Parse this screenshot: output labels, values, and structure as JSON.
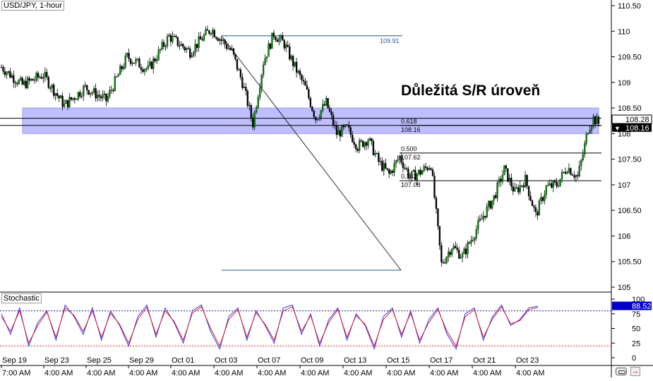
{
  "window": {
    "symbol_label": "USD/JPY, 1-hour",
    "indicator_label": "Stochastic",
    "bottom_icons": [
      "link-icon",
      "arrow-right-icon"
    ]
  },
  "colors": {
    "up_candle": "#0a8a0a",
    "down_candle": "#000000",
    "sr_zone_fill": "#b4b4ff",
    "sr_zone_edge": "#8c8cf0",
    "fib_line": "#1a5aa0",
    "stoch_k": "#3333ff",
    "stoch_d": "#dd2222",
    "overbought_line": "#1a1aa0",
    "oversold_line": "#dd2222",
    "last_price_tag": "#000000",
    "stoch_tag": "#0000cc"
  },
  "annotation": {
    "text": "Důležitá S/R úroveň"
  },
  "chart_data": [
    {
      "type": "candlestick",
      "title": "USD/JPY, 1-hour",
      "ylim": [
        105.0,
        110.6
      ],
      "y_ticks": [
        "110.50",
        "110",
        "109.50",
        "109",
        "108.50",
        "108",
        "107.50",
        "107",
        "106.50",
        "106",
        "105.50",
        "105"
      ],
      "x_ticks": [
        "Sep 19",
        "Sep 23",
        "Sep 25",
        "Sep 29",
        "Oct 01",
        "Oct 03",
        "Oct 07",
        "Oct 09",
        "Oct 13",
        "Oct 15",
        "Oct 17",
        "Oct 21",
        "Oct 23"
      ],
      "x_subticks": [
        "7:00 AM",
        "4:00 AM",
        "4:00 AM",
        "4:00 AM",
        "4:00 AM",
        "4:00 AM",
        "4:00 AM",
        "4:00 AM",
        "4:00 AM",
        "4:00 AM",
        "4:00 AM",
        "4:00 AM",
        "4:00 AM"
      ],
      "price_path": [
        [
          0,
          109.3
        ],
        [
          4,
          108.95
        ],
        [
          8,
          109.15
        ],
        [
          12,
          108.55
        ],
        [
          16,
          108.9
        ],
        [
          20,
          108.65
        ],
        [
          24,
          109.5
        ],
        [
          28,
          109.25
        ],
        [
          32,
          109.9
        ],
        [
          36,
          109.6
        ],
        [
          40,
          110.05
        ],
        [
          44,
          109.6
        ],
        [
          46,
          109.0
        ],
        [
          48,
          108.2
        ],
        [
          50,
          109.4
        ],
        [
          52,
          109.95
        ],
        [
          54,
          109.75
        ],
        [
          56,
          109.3
        ],
        [
          58,
          108.9
        ],
        [
          60,
          108.3
        ],
        [
          62,
          108.6
        ],
        [
          64,
          108.0
        ],
        [
          66,
          108.1
        ],
        [
          68,
          107.75
        ],
        [
          70,
          107.9
        ],
        [
          72,
          107.45
        ],
        [
          74,
          107.2
        ],
        [
          76,
          107.55
        ],
        [
          78,
          107.15
        ],
        [
          80,
          107.25
        ],
        [
          82,
          107.4
        ],
        [
          84,
          105.45
        ],
        [
          86,
          105.8
        ],
        [
          88,
          105.6
        ],
        [
          90,
          106.0
        ],
        [
          92,
          106.4
        ],
        [
          94,
          106.75
        ],
        [
          96,
          107.3
        ],
        [
          98,
          106.85
        ],
        [
          100,
          107.1
        ],
        [
          102,
          106.4
        ],
        [
          104,
          106.95
        ],
        [
          106,
          107.0
        ],
        [
          108,
          107.35
        ],
        [
          110,
          107.15
        ],
        [
          111,
          107.6
        ],
        [
          112,
          108.1
        ],
        [
          113,
          108.3
        ],
        [
          114,
          108.2
        ]
      ],
      "series_sr_zone": {
        "low": 108.0,
        "high": 108.5,
        "label": "Důležitá S/R úroveň"
      },
      "horizontal_lines": [
        {
          "value": 108.3,
          "color": "#000000"
        },
        {
          "value": 108.16,
          "color": "#000000"
        }
      ],
      "fibonacci": {
        "high": 109.91,
        "low": 105.33,
        "levels": [
          {
            "ratio": "0.618",
            "price": "108.16"
          },
          {
            "ratio": "0.500",
            "price": "107.62"
          },
          {
            "ratio": "0.382",
            "price": "107.08"
          }
        ],
        "high_label": "109.91"
      },
      "price_tags": [
        {
          "text": "108.28",
          "kind": "bid"
        },
        {
          "text": "108.16",
          "kind": "last"
        }
      ]
    },
    {
      "type": "line",
      "title": "Stochastic",
      "ylim": [
        0,
        100
      ],
      "y_ticks": [
        "100",
        "75",
        "50",
        "25",
        "0"
      ],
      "levels": {
        "overbought": 80,
        "oversold": 20
      },
      "current_value": "88.52",
      "series": [
        {
          "name": "%K",
          "values": [
            75,
            40,
            85,
            20,
            60,
            80,
            30,
            90,
            70,
            40,
            85,
            30,
            80,
            55,
            20,
            70,
            90,
            35,
            85,
            60,
            25,
            80,
            90,
            45,
            15,
            70,
            85,
            30,
            80,
            55,
            25,
            85,
            90,
            40,
            75,
            20,
            65,
            85,
            30,
            75,
            55,
            15,
            70,
            85,
            35,
            80,
            25,
            65,
            85,
            40,
            15,
            75,
            85,
            30,
            70,
            90,
            55,
            65,
            85,
            88
          ]
        },
        {
          "name": "%D",
          "values": [
            70,
            45,
            80,
            25,
            55,
            78,
            35,
            85,
            72,
            45,
            80,
            35,
            76,
            57,
            25,
            65,
            86,
            40,
            80,
            62,
            30,
            76,
            87,
            50,
            20,
            65,
            82,
            35,
            77,
            57,
            30,
            80,
            87,
            45,
            72,
            25,
            60,
            82,
            35,
            72,
            57,
            20,
            65,
            82,
            40,
            76,
            30,
            60,
            82,
            45,
            20,
            70,
            82,
            35,
            66,
            87,
            58,
            63,
            82,
            86
          ]
        }
      ]
    }
  ]
}
